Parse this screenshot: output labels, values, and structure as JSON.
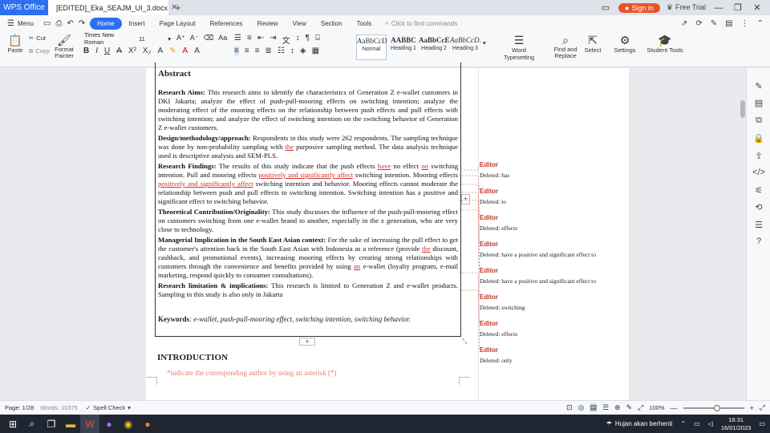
{
  "titlebar": {
    "app_tab": "WPS Office",
    "doc_tab": "[EDITED]_Eka_SEAJM_UI_3.docx",
    "sign_in": "Sign in",
    "free_trial": "Free Trial"
  },
  "menu": {
    "menu_label": "Menu",
    "tabs": [
      "Home",
      "Insert",
      "Page Layout",
      "References",
      "Review",
      "View",
      "Section",
      "Tools"
    ],
    "find_placeholder": "Click to find commands"
  },
  "ribbon": {
    "paste": "Paste",
    "cut": "Cut",
    "copy": "Copy",
    "format_painter": "Format Painter",
    "font_name": "Times New Roman",
    "font_size": "11",
    "styles": [
      {
        "preview": "AaBbCcD",
        "label": "Normal"
      },
      {
        "preview": "AABBC",
        "label": "Heading 1"
      },
      {
        "preview": "AaBbCcE",
        "label": "Heading 2"
      },
      {
        "preview": "AaBbCcD.",
        "label": "Heading 3"
      }
    ],
    "word_typesetting": "Word Typesetting",
    "find_replace": "Find and Replace",
    "select": "Select",
    "settings": "Settings",
    "student_tools": "Student Tools"
  },
  "document": {
    "abstract_title": "Abstract",
    "aims_label": "Research Aims:",
    "aims_text": "This research aims to identify the characteristics of Generation Z e-wallet customers in DKI Jakarta; analyze the effect of push-pull-mooring effects on switching intention; analyze the moderating effect of the mooring effects on the relationship between push effects and pull effects with switching intention; and analyze the effect of switching intention on the switching behavior of Generation Z e-wallet customers.",
    "design_label": "Design/methodology/approach:",
    "design_text_a": "Respondents in this study were 262 respondents. The sampling technique was done by non-probability sampling with",
    "design_ins": "the",
    "design_text_b": "purposive sampling method. The data analysis technique used is descriptive analysis and SEM-PLS.",
    "findings_label": "Research Findings:",
    "findings_a": "The results of this study indicate that the push effects",
    "findings_ins1": "have",
    "findings_b": "no effect",
    "findings_ins2": "on",
    "findings_c": "switching intention. Pull and mooring effects",
    "findings_ins3": "positively and significantly affect",
    "findings_d": "switching intention. Mooring effects",
    "findings_ins4": "positively and significantly affect",
    "findings_e": "switching intention and behavior. Mooring effects cannot moderate the relationship between push and pull effects to switching intention. Switching intention has a positive and significant effect to switching behavior.",
    "theory_label": "Theoretical Contribution/Originality:",
    "theory_text": "This study discusses the influence of the push-pull-mooring effect on customers switching from one e-wallet brand to another, especially in the z generation, who are very close to technology.",
    "managerial_label": "Managerial Implication in the South East Asian context:",
    "managerial_a": "For the sake of increasing the pull effect to get the customer's attention back in the South East Asian with Indonesia as a reference (provide",
    "managerial_ins1": "the",
    "managerial_b": "discount, cashback, and promotional events), increasing mooring effects by creating strong relationships with customers through the convenience and benefits provided by using",
    "managerial_ins2": "an",
    "managerial_c": "e-wallet (loyalty program, e-mail marketing, respond quickly to consumer consultations).",
    "limitation_label": "Research limitation & implications:",
    "limitation_text": "This research is limited to Generation Z and e-wallet products. Sampling in this study is also only in Jakarta",
    "keywords_label": "Keywords",
    "keywords_text": ": e-wallet, push-pull-mooring effect, switching intention, switching behavior.",
    "intro_heading": "INTRODUCTION",
    "author_note": "*indicate the corresponding author by using an asterisk (*)"
  },
  "comments": [
    {
      "author": "Editor",
      "text": "Deleted:  has"
    },
    {
      "author": "Editor",
      "text": "Deleted:  to"
    },
    {
      "author": "Editor",
      "text": "Deleted:  effects"
    },
    {
      "author": "Editor",
      "text": "Deleted:  have a positive and significant effect to"
    },
    {
      "author": "Editor",
      "text": "Deleted:  have a positive and significant effect to"
    },
    {
      "author": "Editor",
      "text": "Deleted:  switching"
    },
    {
      "author": "Editor",
      "text": "Deleted:  effects"
    },
    {
      "author": "Editor",
      "text": "Deleted:  only"
    }
  ],
  "status": {
    "page": "Page: 1/28",
    "words": "Words: 10375",
    "spell_check": "Spell Check",
    "zoom": "100%"
  },
  "taskbar": {
    "weather": "Hujan akan berhenti",
    "time": "16:31",
    "date": "16/01/2023"
  }
}
